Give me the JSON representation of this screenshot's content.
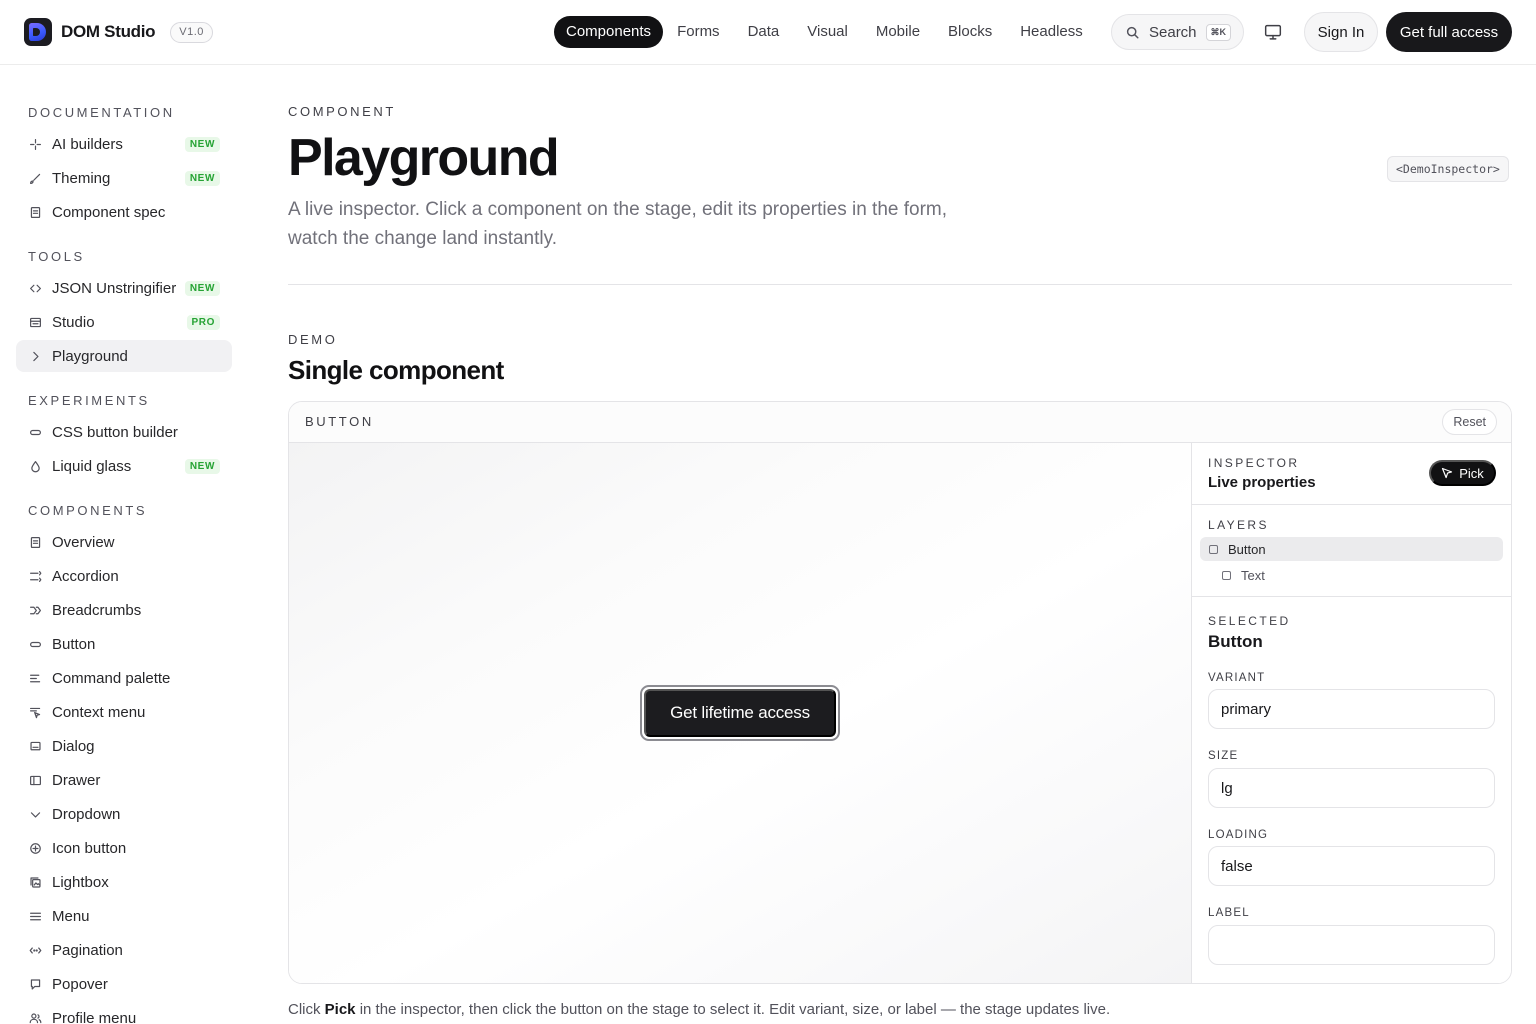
{
  "header": {
    "brand": "DOM Studio",
    "version": "V1.0",
    "nav": [
      "Components",
      "Forms",
      "Data",
      "Visual",
      "Mobile",
      "Blocks",
      "Headless"
    ],
    "active_nav": "Components",
    "search_label": "Search",
    "search_shortcut": "⌘K",
    "signin": "Sign In",
    "cta": "Get full access"
  },
  "sidebar": {
    "sections": [
      {
        "title": "DOCUMENTATION",
        "items": [
          {
            "label": "AI builders",
            "icon": "sparkle-icon",
            "badge": "NEW"
          },
          {
            "label": "Theming",
            "icon": "brush-icon",
            "badge": "NEW"
          },
          {
            "label": "Component spec",
            "icon": "document-icon",
            "badge": ""
          }
        ]
      },
      {
        "title": "TOOLS",
        "items": [
          {
            "label": "JSON Unstringifier",
            "icon": "code-brackets-icon",
            "badge": "NEW"
          },
          {
            "label": "Studio",
            "icon": "layout-icon",
            "badge": "PRO"
          },
          {
            "label": "Playground",
            "icon": "chevron-right-icon",
            "badge": "",
            "active": true
          }
        ]
      },
      {
        "title": "EXPERIMENTS",
        "items": [
          {
            "label": "CSS button builder",
            "icon": "pill-icon",
            "badge": ""
          },
          {
            "label": "Liquid glass",
            "icon": "droplet-icon",
            "badge": "NEW"
          }
        ]
      },
      {
        "title": "COMPONENTS",
        "items": [
          {
            "label": "Overview",
            "icon": "document-icon",
            "badge": ""
          },
          {
            "label": "Accordion",
            "icon": "accordion-icon",
            "badge": ""
          },
          {
            "label": "Breadcrumbs",
            "icon": "breadcrumb-icon",
            "badge": ""
          },
          {
            "label": "Button",
            "icon": "pill-icon",
            "badge": ""
          },
          {
            "label": "Command palette",
            "icon": "command-list-icon",
            "badge": ""
          },
          {
            "label": "Context menu",
            "icon": "cursor-menu-icon",
            "badge": ""
          },
          {
            "label": "Dialog",
            "icon": "dialog-icon",
            "badge": ""
          },
          {
            "label": "Drawer",
            "icon": "drawer-icon",
            "badge": ""
          },
          {
            "label": "Dropdown",
            "icon": "chevron-down-icon",
            "badge": ""
          },
          {
            "label": "Icon button",
            "icon": "plus-circle-icon",
            "badge": ""
          },
          {
            "label": "Lightbox",
            "icon": "image-stack-icon",
            "badge": ""
          },
          {
            "label": "Menu",
            "icon": "hamburger-icon",
            "badge": ""
          },
          {
            "label": "Pagination",
            "icon": "pagination-icon",
            "badge": ""
          },
          {
            "label": "Popover",
            "icon": "popover-icon",
            "badge": ""
          },
          {
            "label": "Profile menu",
            "icon": "users-icon",
            "badge": ""
          }
        ]
      }
    ]
  },
  "main": {
    "eyebrow": "COMPONENT",
    "title": "Playground",
    "component_tag": "<DemoInspector>",
    "lead": "A live inspector. Click a component on the stage, edit its properties in the form, watch the change land instantly.",
    "demo_eyebrow": "DEMO",
    "demo_title": "Single component",
    "panel": {
      "label": "BUTTON",
      "reset": "Reset",
      "stage_button": "Get lifetime access"
    },
    "inspector": {
      "eyebrow": "INSPECTOR",
      "title": "Live properties",
      "pick": "Pick",
      "layers_title": "LAYERS",
      "layers": [
        "Button",
        "Text"
      ],
      "selected_title": "SELECTED",
      "selected_name": "Button",
      "fields": [
        {
          "label": "VARIANT",
          "value": "primary"
        },
        {
          "label": "SIZE",
          "value": "lg"
        },
        {
          "label": "LOADING",
          "value": "false"
        },
        {
          "label": "LABEL",
          "value": ""
        }
      ]
    },
    "footnote": {
      "pre": "Click ",
      "bold": "Pick",
      "post": " in the inspector, then click the button on the stage to select it. Edit variant, size, or label — the stage updates live."
    }
  },
  "colors": {
    "accent": "#111113",
    "badge_bg": "#e8f8e8",
    "badge_text": "#26a334"
  }
}
